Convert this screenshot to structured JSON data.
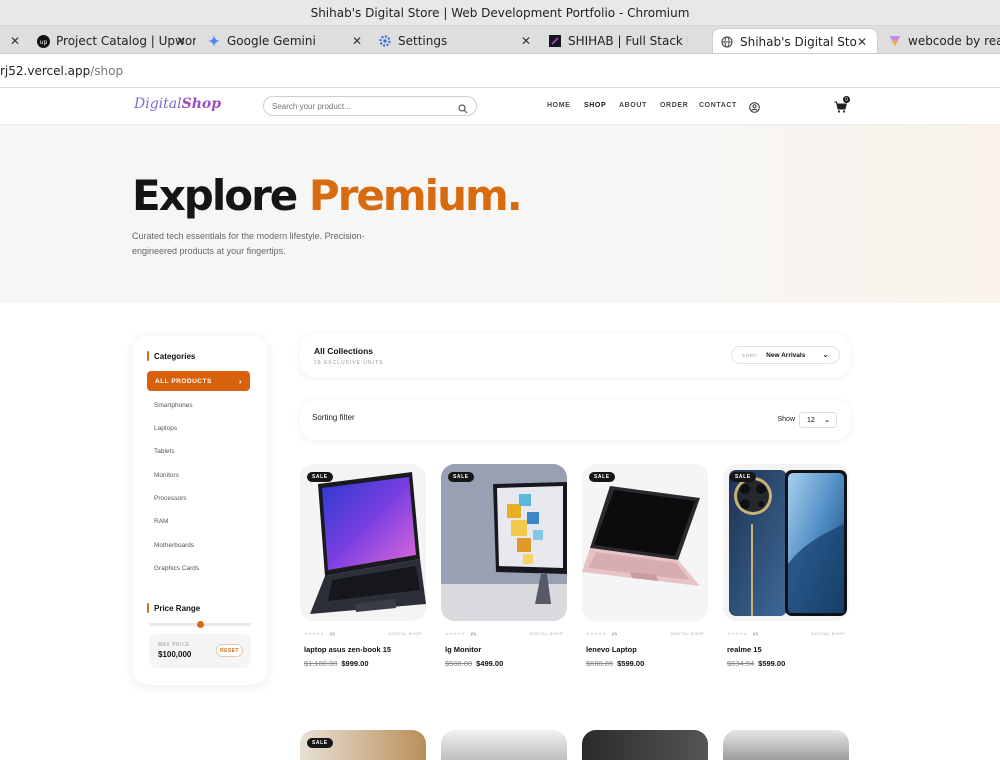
{
  "window": {
    "title": "Shihab's Digital Store | Web Development Portfolio - Chromium"
  },
  "tabs": [
    {
      "label": "Project Catalog | Upwork",
      "icon": "upwork-icon"
    },
    {
      "label": "Google Gemini",
      "icon": "gemini-icon"
    },
    {
      "label": "Settings",
      "icon": "settings-gear-icon"
    },
    {
      "label": "SHIHAB | Full Stack MERN",
      "icon": "site-favicon"
    },
    {
      "label": "Shihab's Digital Store | W",
      "icon": "globe-icon",
      "active": true
    },
    {
      "label": "webcode by react a",
      "icon": "vercel-icon"
    }
  ],
  "address": {
    "host": "rj52.vercel.app",
    "path": "/shop"
  },
  "header": {
    "logo_a": "Digital",
    "logo_b": "Shop",
    "search_placeholder": "Search your product...",
    "nav": [
      "HOME",
      "SHOP",
      "ABOUT",
      "ORDER",
      "CONTACT"
    ],
    "active_nav": "SHOP",
    "cart_count": "0"
  },
  "hero": {
    "title_a": "Explore",
    "title_b": "Premium.",
    "subtitle": "Curated tech essentials for the modern lifestyle. Precision-engineered products at your fingertips."
  },
  "sidebar": {
    "categories_heading": "Categories",
    "active_category": "ALL PRODUCTS",
    "categories": [
      "Smartphones",
      "Laptops",
      "Tablets",
      "Monitors",
      "Processors",
      "RAM",
      "Motherboards",
      "Graphics Cards"
    ],
    "price_heading": "Price Range",
    "max_price_label": "MAX PRICE",
    "max_price_value": "$100,000",
    "reset_label": "RESET",
    "accent": "#d8620b"
  },
  "collection": {
    "title": "All Collections",
    "subtitle": "28 EXCLUSIVE UNITS",
    "sort_label": "SORT:",
    "sort_value": "New Arrivals"
  },
  "filter": {
    "label": "Sorting filter",
    "show_label": "Show",
    "show_value": "12"
  },
  "products": [
    {
      "badge": "SALE",
      "name": "laptop asus zen-book 15",
      "old_price": "$1,108.80",
      "new_price": "$999.00",
      "reviews": "(0)",
      "brand": "DIGITAL SHOP"
    },
    {
      "badge": "SALE",
      "name": "lg Monitor",
      "old_price": "$508.80",
      "new_price": "$499.00",
      "reviews": "(0)",
      "brand": "DIGITAL SHOP"
    },
    {
      "badge": "SALE",
      "name": "lenevo Laptop",
      "old_price": "$688.85",
      "new_price": "$599.00",
      "reviews": "(0)",
      "brand": "DIGITAL SHOP"
    },
    {
      "badge": "SALE",
      "name": "realme 15",
      "old_price": "$634.94",
      "new_price": "$599.00",
      "reviews": "(0)",
      "brand": "DIGITAL SHOP"
    }
  ],
  "second_row_badge": "SALE"
}
